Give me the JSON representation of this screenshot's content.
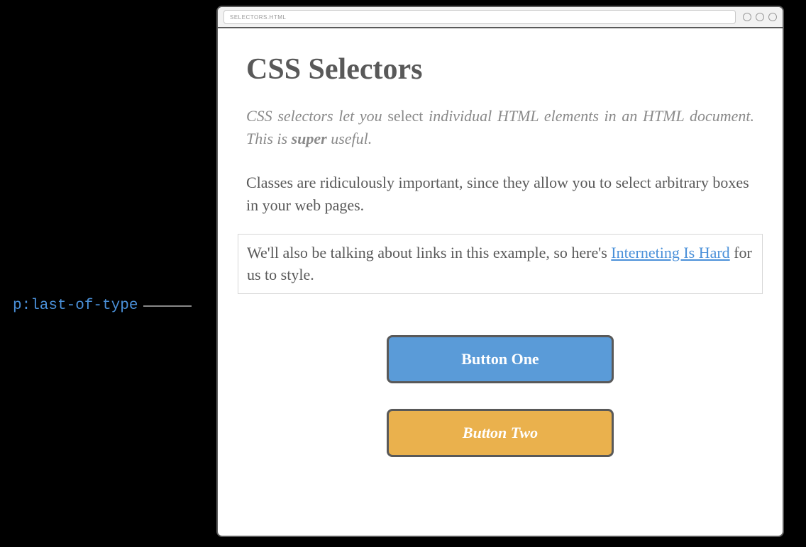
{
  "annotation": {
    "label": "p:last-of-type"
  },
  "window": {
    "url": "SELECTORS.HTML"
  },
  "page": {
    "title": "CSS Selectors",
    "intro_part1": "CSS selectors let you ",
    "intro_part2": "select",
    "intro_part3": " individual HTML elements in an HTML document. This is ",
    "intro_super": "super",
    "intro_part4": " useful.",
    "para2": "Classes are ridiculously important, since they allow you to select arbitrary boxes in your web pages.",
    "para3_part1": "We'll also be talking about links in this example, so here's ",
    "para3_link": "Interneting Is Hard",
    "para3_part2": " for us to style.",
    "button1": "Button One",
    "button2": "Button Two"
  }
}
